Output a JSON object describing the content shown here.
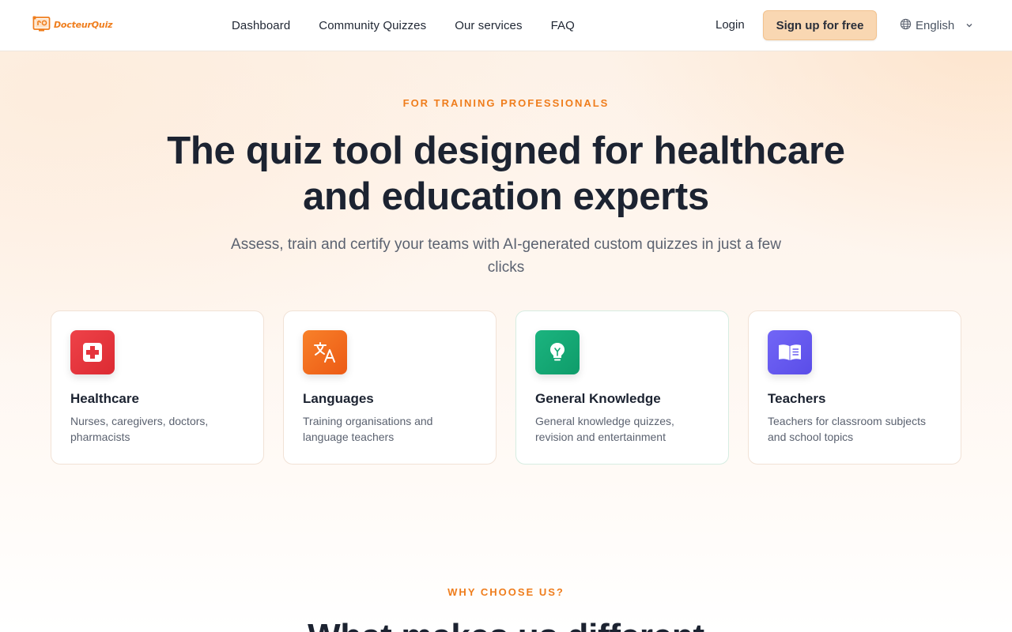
{
  "brand": {
    "name": "DocteurQuiz",
    "accent": "#ef7d1c"
  },
  "nav": {
    "items": [
      {
        "label": "Dashboard"
      },
      {
        "label": "Community Quizzes"
      },
      {
        "label": "Our services"
      },
      {
        "label": "FAQ"
      }
    ],
    "login_label": "Login",
    "signup_label": "Sign up for free",
    "language": {
      "selected": "English",
      "icon": "globe-icon"
    }
  },
  "hero": {
    "eyebrow": "FOR TRAINING PROFESSIONALS",
    "title_line1": "The quiz tool designed for healthcare",
    "title_line2": "and education experts",
    "subtitle": "Assess, train and certify your teams with AI-generated custom quizzes in just a few clicks"
  },
  "cards": [
    {
      "title": "Healthcare",
      "description": "Nurses, caregivers, doctors, pharmacists",
      "icon": "medical-cross-icon",
      "color": "#e5343c"
    },
    {
      "title": "Languages",
      "description": "Training organisations and language teachers",
      "icon": "translate-icon",
      "color": "#f26b1d"
    },
    {
      "title": "General Knowledge",
      "description": "General knowledge quizzes, revision and entertainment",
      "icon": "lightbulb-icon",
      "color": "#13a874"
    },
    {
      "title": "Teachers",
      "description": "Teachers for classroom subjects and school topics",
      "icon": "open-book-icon",
      "color": "#6a5cf2"
    }
  ],
  "why": {
    "eyebrow": "WHY CHOOSE US?",
    "title": "What makes us different"
  }
}
